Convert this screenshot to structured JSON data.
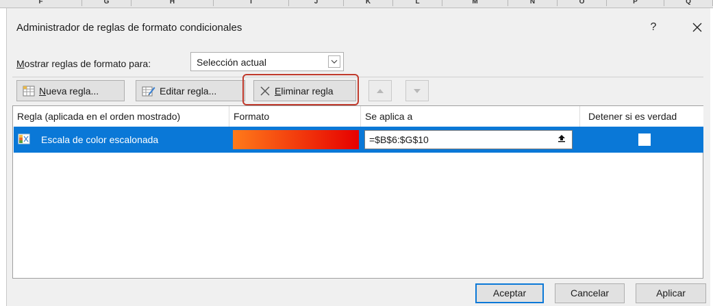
{
  "sheet_columns": [
    "F",
    "G",
    "H",
    "I",
    "J",
    "K",
    "L",
    "M",
    "N",
    "O",
    "P",
    "Q"
  ],
  "dialog": {
    "title": "Administrador de reglas de formato condicionales",
    "help_label": "?",
    "close_label": "✕"
  },
  "show_rules": {
    "label_prefix": "M",
    "label_rest": "ostrar reglas de formato para:",
    "selected": "Selección actual"
  },
  "toolbar": {
    "new_rule": {
      "underline": "N",
      "rest": "ueva regla..."
    },
    "edit_rule": {
      "text": "Editar regla",
      "underline": "",
      "rest": "..."
    },
    "delete_rule": {
      "underline": "E",
      "rest": "liminar regla"
    },
    "move_up_icon": "arrow-up",
    "move_down_icon": "arrow-down"
  },
  "columns": {
    "rule": "Regla (aplicada en el orden mostrado)",
    "format": "Formato",
    "applies_to": "Se aplica a",
    "stop_if_true": "Detener si es verdad"
  },
  "rules": [
    {
      "name": "Escala de color escalonada",
      "format_gradient_from": "#ff7a1a",
      "format_gradient_to": "#e60000",
      "applies_to": "=$B$6:$G$10",
      "stop_if_true": false
    }
  ],
  "buttons": {
    "accept": "Aceptar",
    "cancel": "Cancelar",
    "apply": "Aplicar"
  },
  "colors": {
    "selection": "#0a78d7",
    "highlight": "#c0392b"
  }
}
